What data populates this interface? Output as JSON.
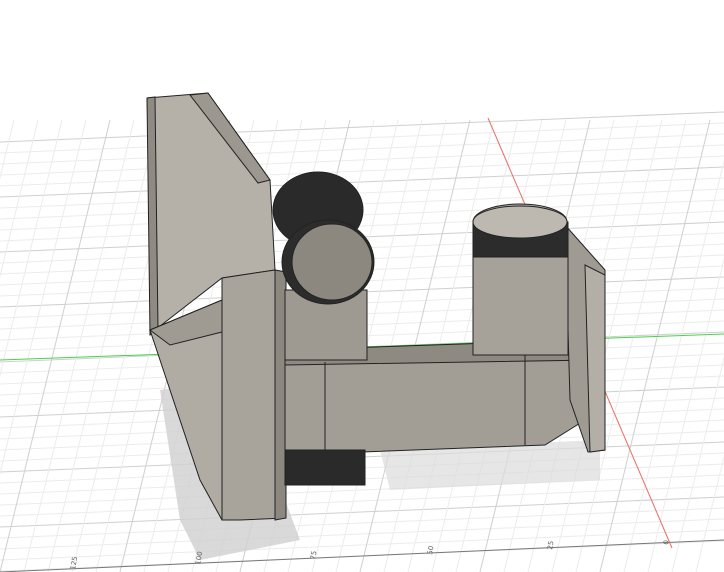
{
  "viewport": {
    "name": "3D modeling viewport",
    "axis_colors": {
      "x": "#e0504a",
      "y": "#3ac83a"
    },
    "body_color": "#a8a49c",
    "ruler_ticks": [
      "125",
      "100",
      "75",
      "50",
      "25",
      "0"
    ]
  }
}
